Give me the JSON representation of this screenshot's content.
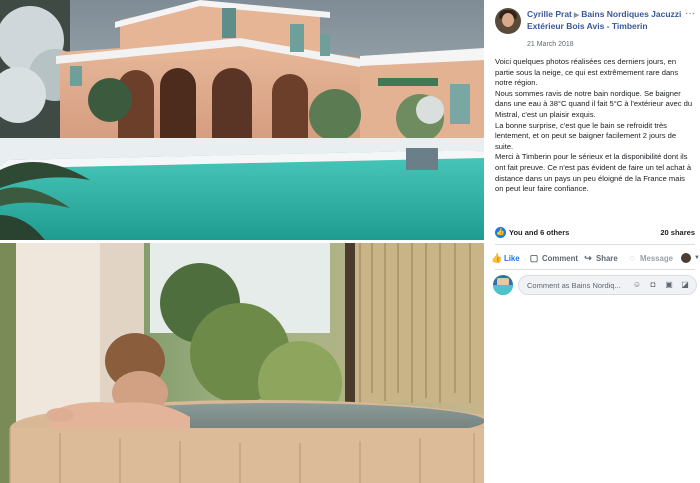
{
  "post": {
    "author": "Cyrille Prat",
    "page": "Bains Nordiques Jacuzzi Extérieur Bois Avis - Timberin",
    "date": "21 March 2018",
    "menu": "···",
    "paragraphs": [
      "Voici quelques photos réalisées ces derniers jours, en partie sous la neige, ce qui est extrêmement rare dans notre région.",
      "Nous sommes ravis de notre bain nordique. Se baigner dans une eau à 38°C quand il fait 5°C à l'extérieur avec du Mistral, c'est un plaisir exquis.",
      "La bonne surprise, c'est que le bain se refroidit très lentement, et on peut se baigner facilement 2 jours de suite.",
      "Merci à Timberin pour le sérieux et la disponibilité dont ils ont fait preuve. Ce n'est pas évident de faire un tel achat à distance dans un pays un peu éloigné de la France mais on peut leur faire confiance."
    ]
  },
  "reactions": {
    "icon": "👍",
    "text": "You and 6 others",
    "shares": "20 shares"
  },
  "actions": {
    "like": "Like",
    "comment": "Comment",
    "share": "Share",
    "message": "Message"
  },
  "comment_box": {
    "placeholder": "Comment as Bains Nordiq..."
  },
  "icons": {
    "like": "thumbs-up-icon",
    "comment": "speech-bubble-icon",
    "share": "share-arrow-icon",
    "message": "messenger-icon",
    "emoji": "smiley-icon",
    "camera": "camera-icon",
    "gif": "gif-icon",
    "sticker": "sticker-icon"
  },
  "colors": {
    "link": "#385898",
    "accent": "#1877f2",
    "pool": "#2fb3a6"
  }
}
